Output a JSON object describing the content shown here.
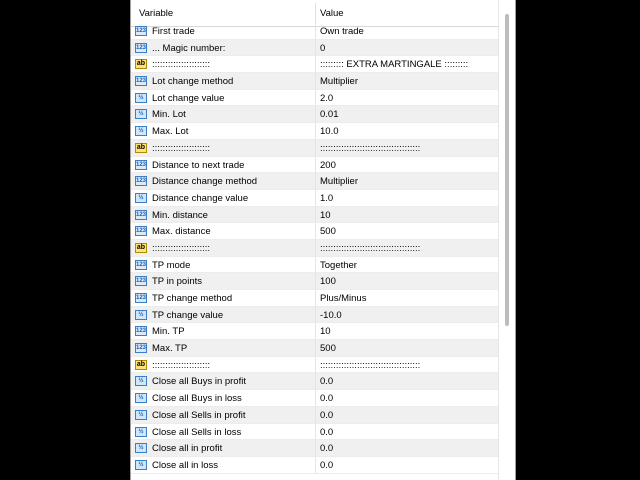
{
  "headers": {
    "variable": "Variable",
    "value": "Value"
  },
  "rows": [
    {
      "icon": "123",
      "name": "First trade",
      "value": "Own trade"
    },
    {
      "icon": "123",
      "name": "... Magic number:",
      "value": "0"
    },
    {
      "icon": "ab",
      "name": "::::::::::::::::::::::",
      "value": "::::::::: EXTRA MARTINGALE :::::::::"
    },
    {
      "icon": "123",
      "name": "Lot change method",
      "value": "Multiplier"
    },
    {
      "icon": "ve",
      "name": "Lot change value",
      "value": "2.0"
    },
    {
      "icon": "ve",
      "name": "Min. Lot",
      "value": "0.01"
    },
    {
      "icon": "ve",
      "name": "Max. Lot",
      "value": "10.0"
    },
    {
      "icon": "ab",
      "name": "::::::::::::::::::::::",
      "value": "::::::::::::::::::::::::::::::::::::::"
    },
    {
      "icon": "123",
      "name": "Distance to next trade",
      "value": "200"
    },
    {
      "icon": "123",
      "name": "Distance change method",
      "value": "Multiplier"
    },
    {
      "icon": "ve",
      "name": "Distance change value",
      "value": "1.0"
    },
    {
      "icon": "123",
      "name": "Min. distance",
      "value": "10"
    },
    {
      "icon": "123",
      "name": "Max. distance",
      "value": "500"
    },
    {
      "icon": "ab",
      "name": "::::::::::::::::::::::",
      "value": "::::::::::::::::::::::::::::::::::::::"
    },
    {
      "icon": "123",
      "name": "TP mode",
      "value": "Together"
    },
    {
      "icon": "123",
      "name": "TP in points",
      "value": "100"
    },
    {
      "icon": "123",
      "name": "TP change method",
      "value": "Plus/Minus"
    },
    {
      "icon": "ve",
      "name": "TP change value",
      "value": "-10.0"
    },
    {
      "icon": "123",
      "name": "Min. TP",
      "value": "10"
    },
    {
      "icon": "123",
      "name": "Max. TP",
      "value": "500"
    },
    {
      "icon": "ab",
      "name": "::::::::::::::::::::::",
      "value": "::::::::::::::::::::::::::::::::::::::"
    },
    {
      "icon": "ve",
      "name": "Close all Buys in profit",
      "value": "0.0"
    },
    {
      "icon": "ve",
      "name": "Close all Buys in loss",
      "value": "0.0"
    },
    {
      "icon": "ve",
      "name": "Close all Sells in profit",
      "value": "0.0"
    },
    {
      "icon": "ve",
      "name": "Close all Sells in loss",
      "value": "0.0"
    },
    {
      "icon": "ve",
      "name": "Close all in profit",
      "value": "0.0"
    },
    {
      "icon": "ve",
      "name": "Close all in loss",
      "value": "0.0"
    }
  ]
}
